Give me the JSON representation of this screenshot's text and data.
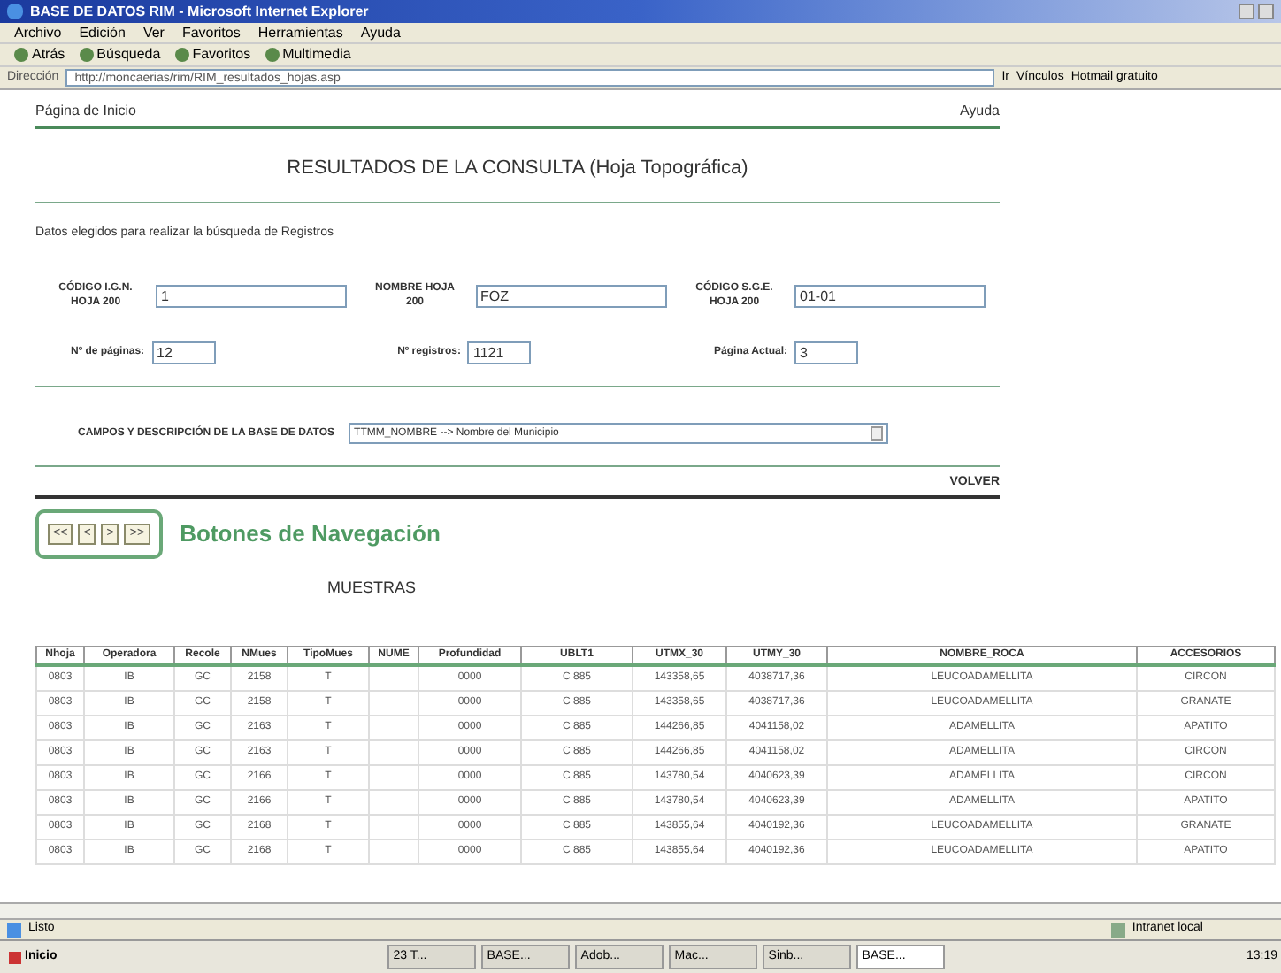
{
  "window": {
    "title": "BASE DE DATOS RIM - Microsoft Internet Explorer"
  },
  "menu": [
    "Archivo",
    "Edición",
    "Ver",
    "Favoritos",
    "Herramientas",
    "Ayuda"
  ],
  "toolbar": [
    "Atrás",
    "Búsqueda",
    "Favoritos",
    "Multimedia"
  ],
  "address_bar": {
    "label": "Dirección",
    "value": "http://moncaerias/rim/RIM_resultados_hojas.asp",
    "go": "Ir",
    "links": "Vínculos",
    "hotmail": "Hotmail gratuito"
  },
  "page": {
    "home_link": "Página de Inicio",
    "help_link": "Ayuda",
    "heading": "RESULTADOS DE LA CONSULTA (Hoja Topográfica)",
    "intro": "Datos elegidos para realizar la búsqueda de Registros",
    "fields_row1": [
      {
        "label": "CÓDIGO I.G.N. HOJA 200",
        "value": "1"
      },
      {
        "label": "NOMBRE HOJA 200",
        "value": "FOZ"
      },
      {
        "label": "CÓDIGO S.G.E. HOJA 200",
        "value": "01-01"
      }
    ],
    "fields_row2": [
      {
        "label": "Nº de páginas:",
        "value": "12"
      },
      {
        "label": "Nº registros:",
        "value": "1121"
      },
      {
        "label": "Página Actual:",
        "value": "3"
      }
    ],
    "campos": {
      "label": "CAMPOS Y DESCRIPCIÓN DE LA BASE DE DATOS",
      "value": "TTMM_NOMBRE --> Nombre del Municipio"
    },
    "volver": "VOLVER",
    "nav_buttons": [
      "<<",
      "<",
      ">",
      ">>"
    ],
    "nav_label": "Botones de Navegación",
    "section": "MUESTRAS"
  },
  "table": {
    "columns": [
      "Nhoja",
      "Operadora",
      "Recole",
      "NMues",
      "TipoMues",
      "NUME",
      "Profundidad",
      "UBLT1",
      "UTMX_30",
      "UTMY_30",
      "NOMBRE_ROCA",
      "ACCESORIOS"
    ],
    "rows": [
      [
        "0803",
        "IB",
        "GC",
        "2158",
        "T",
        null,
        "0000",
        "C 885",
        "143358,65",
        "4038717,36",
        "LEUCOADAMELLITA",
        "CIRCON"
      ],
      [
        "0803",
        "IB",
        "GC",
        "2158",
        "T",
        null,
        "0000",
        "C 885",
        "143358,65",
        "4038717,36",
        "LEUCOADAMELLITA",
        "GRANATE"
      ],
      [
        "0803",
        "IB",
        "GC",
        "2163",
        "T",
        null,
        "0000",
        "C 885",
        "144266,85",
        "4041158,02",
        "ADAMELLITA",
        "APATITO"
      ],
      [
        "0803",
        "IB",
        "GC",
        "2163",
        "T",
        null,
        "0000",
        "C 885",
        "144266,85",
        "4041158,02",
        "ADAMELLITA",
        "CIRCON"
      ],
      [
        "0803",
        "IB",
        "GC",
        "2166",
        "T",
        null,
        "0000",
        "C 885",
        "143780,54",
        "4040623,39",
        "ADAMELLITA",
        "CIRCON"
      ],
      [
        "0803",
        "IB",
        "GC",
        "2166",
        "T",
        null,
        "0000",
        "C 885",
        "143780,54",
        "4040623,39",
        "ADAMELLITA",
        "APATITO"
      ],
      [
        "0803",
        "IB",
        "GC",
        "2168",
        "T",
        null,
        "0000",
        "C 885",
        "143855,64",
        "4040192,36",
        "LEUCOADAMELLITA",
        "GRANATE"
      ],
      [
        "0803",
        "IB",
        "GC",
        "2168",
        "T",
        null,
        "0000",
        "C 885",
        "143855,64",
        "4040192,36",
        "LEUCOADAMELLITA",
        "APATITO"
      ]
    ]
  },
  "status_bar": {
    "text": "Listo",
    "zone": "Intranet local"
  },
  "taskbar": {
    "start": "Inicio",
    "tasks": [
      {
        "label": "23 T...",
        "selected": false
      },
      {
        "label": "BASE...",
        "selected": false
      },
      {
        "label": "Adob...",
        "selected": false
      },
      {
        "label": "Mac...",
        "selected": false
      },
      {
        "label": "Sinb...",
        "selected": false
      },
      {
        "label": "BASE...",
        "selected": true
      }
    ],
    "clock": "13:19"
  }
}
